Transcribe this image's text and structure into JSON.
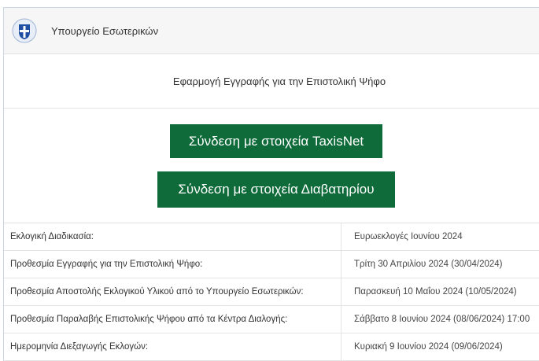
{
  "header": {
    "ministry": "Υπουργείο Εσωτερικών",
    "logo_icon": "greek-coat-of-arms-icon"
  },
  "app": {
    "subtitle": "Εφαρμογή Εγγραφής για την Επιστολική Ψήφο"
  },
  "buttons": {
    "taxisnet_label": "Σύνδεση με στοιχεία TaxisNet",
    "passport_label": "Σύνδεση με στοιχεία Διαβατηρίου"
  },
  "info_rows": [
    {
      "label": "Εκλογική Διαδικασία:",
      "value": "Ευρωεκλογές Ιουνίου 2024"
    },
    {
      "label": "Προθεσμία Εγγραφής για την Επιστολική Ψήφο:",
      "value": "Τρίτη 30 Απριλίου 2024 (30/04/2024)"
    },
    {
      "label": "Προθεσμία Αποστολής Εκλογικού Υλικού από το Υπουργείο Εσωτερικών:",
      "value": "Παρασκευή 10 Μαΐου 2024 (10/05/2024)"
    },
    {
      "label": "Προθεσμία Παραλαβής Επιστολικής Ψήφου από τα Κέντρα Διαλογής:",
      "value": "Σάββατο 8 Ιουνίου 2024 (08/06/2024) 17:00"
    },
    {
      "label": "Ημερομηνία Διεξαγωγής Εκλογών:",
      "value": "Κυριακή 9 Ιουνίου 2024 (09/06/2024)"
    }
  ],
  "colors": {
    "button_green": "#0f6b3a",
    "logo_blue": "#1f4fa3"
  }
}
